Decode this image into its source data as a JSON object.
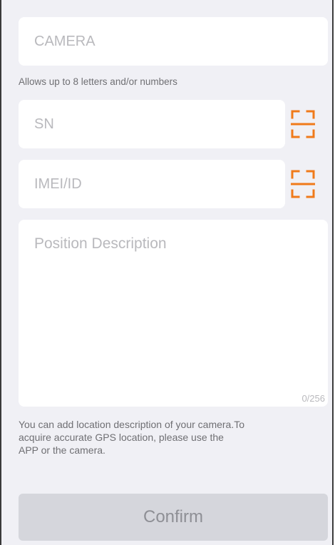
{
  "form": {
    "camera_placeholder": "CAMERA",
    "camera_hint": "Allows up to 8 letters and/or numbers",
    "sn_placeholder": "SN",
    "imei_placeholder": "IMEI/ID",
    "position_placeholder": "Position Description",
    "position_counter": "0/256",
    "position_hint_line1": "You can add location description of your camera.To",
    "position_hint_line2": "acquire accurate GPS location, please use the",
    "position_hint_line3": "APP or the camera.",
    "confirm_label": "Confirm"
  },
  "icons": {
    "sn_scan": "scan-icon",
    "imei_scan": "scan-icon"
  },
  "colors": {
    "accent": "#f07a1a",
    "background": "#f0f0f5",
    "button_disabled": "#d5d6dc",
    "placeholder": "#b9b9bd"
  }
}
